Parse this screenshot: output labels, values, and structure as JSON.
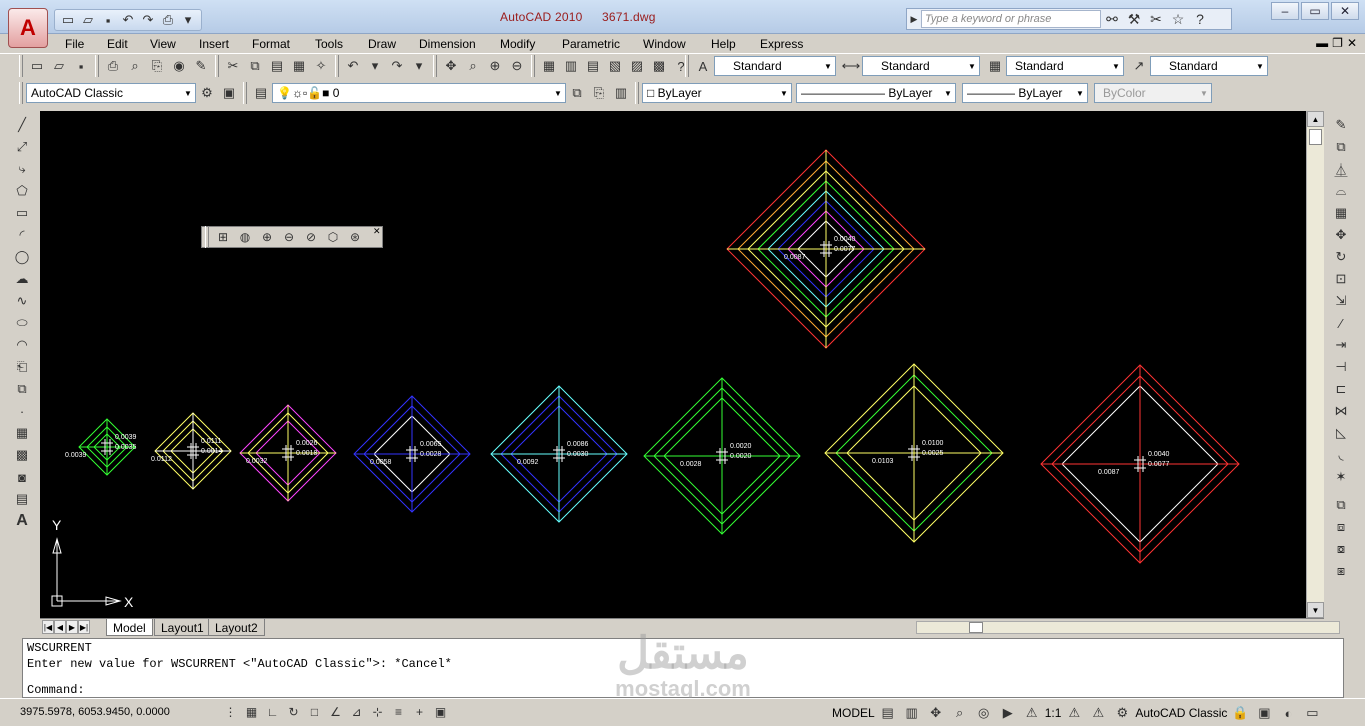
{
  "title": {
    "app": "AutoCAD 2010",
    "file": "3671.dwg"
  },
  "app_button": {
    "label": "A"
  },
  "search": {
    "placeholder": "Type a keyword or phrase"
  },
  "menu": [
    "File",
    "Edit",
    "View",
    "Insert",
    "Format",
    "Tools",
    "Draw",
    "Dimension",
    "Modify",
    "Parametric",
    "Window",
    "Help",
    "Express"
  ],
  "styles": {
    "text_style": "Standard",
    "dim_style": "Standard",
    "table_style": "Standard",
    "mleader_style": "Standard"
  },
  "workspace": "AutoCAD Classic",
  "layer": "0",
  "properties": {
    "color": "ByLayer",
    "linetype": "ByLayer",
    "lineweight": "ByLayer",
    "plotstyle": "ByColor"
  },
  "tabs": [
    "Model",
    "Layout1",
    "Layout2"
  ],
  "ucs": {
    "x": "X",
    "y": "Y"
  },
  "dim_labels": {
    "d1": [
      "0.0039",
      "0.0035",
      "0.0039"
    ],
    "d2": [
      "0.0111",
      "0.0014",
      "0.0112"
    ],
    "d3": [
      "0.0026",
      "0.0018",
      "0.0032"
    ],
    "d4": [
      "0.0065",
      "0.0028",
      "0.0058"
    ],
    "d5": [
      "0.0086",
      "0.0030",
      "0.0092"
    ],
    "d6": [
      "0.0020",
      "0.0020",
      "0.0028"
    ],
    "d7": [
      "0.0100",
      "0.0025",
      "0.0103"
    ],
    "d8": [
      "0.0040",
      "0.0077",
      "0.0087"
    ],
    "d9": [
      "0.0040",
      "0.0077",
      "0.0087"
    ]
  },
  "command": {
    "history": [
      "WSCURRENT",
      "Enter new value for WSCURRENT <\"AutoCAD Classic\">: *Cancel*"
    ],
    "prompt": "Command:"
  },
  "status": {
    "coords": "3975.5978, 6053.9450, 0.0000",
    "model": "MODEL",
    "scale": "1:1",
    "workspace": "AutoCAD Classic"
  },
  "watermark": {
    "line1": "مستقل",
    "line2": "mostaql.com"
  }
}
